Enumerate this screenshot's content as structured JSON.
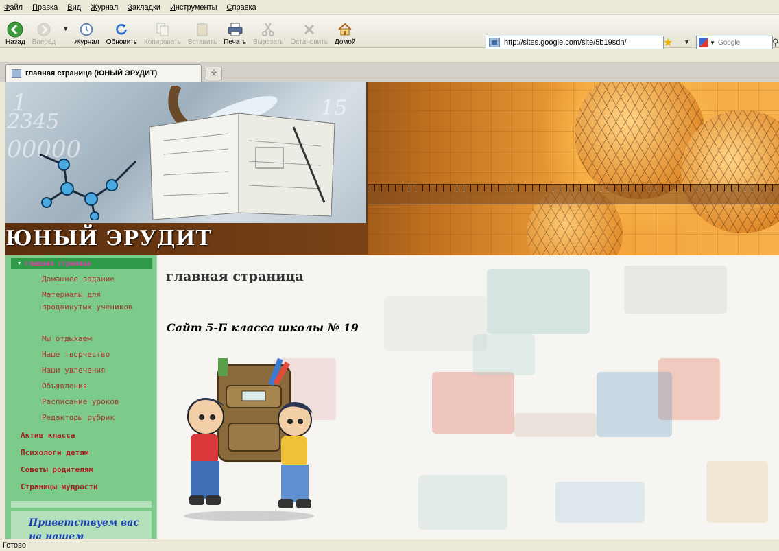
{
  "menu": [
    "Файл",
    "Правка",
    "Вид",
    "Журнал",
    "Закладки",
    "Инструменты",
    "Справка"
  ],
  "toolbar": {
    "back": "Назад",
    "forward": "Вперёд",
    "history": "Журнал",
    "reload": "Обновить",
    "copy": "Копировать",
    "paste": "Вставить",
    "print": "Печать",
    "cut": "Вырезать",
    "stop": "Остановить",
    "home": "Домой"
  },
  "address": {
    "url": "http://sites.google.com/site/5b19sdn/"
  },
  "search": {
    "placeholder": "Google"
  },
  "tab": {
    "title": "главная страница (ЮНЫЙ ЭРУДИТ)"
  },
  "site": {
    "title": "ЮНЫЙ ЭРУДИТ"
  },
  "sidebar": {
    "current": "главная страница",
    "sub_items": [
      "Домашнее задание",
      "Материалы для продвинутых учеников",
      "Мы отдыхаем",
      "Наше творчество",
      "Наши увлечения",
      "Объявления",
      "Расписание уроков",
      "Редакторы рубрик"
    ],
    "main_items": [
      "Актив класса",
      "Психологи детям",
      "Советы родителям",
      "Страницы мудрости"
    ],
    "welcome": "Приветствуем вас на нашем"
  },
  "main": {
    "title": "главная страница",
    "subtitle": "Сайт 5-Б класса школы № 19"
  },
  "status": {
    "text": "Готово"
  },
  "colors": {
    "sidebar_bg": "#7dcb8a",
    "nav_current_bg": "#2e9b48",
    "nav_current_text": "#e03fb0",
    "nav_link": "#a93535",
    "welcome_text": "#1b3fb6"
  }
}
